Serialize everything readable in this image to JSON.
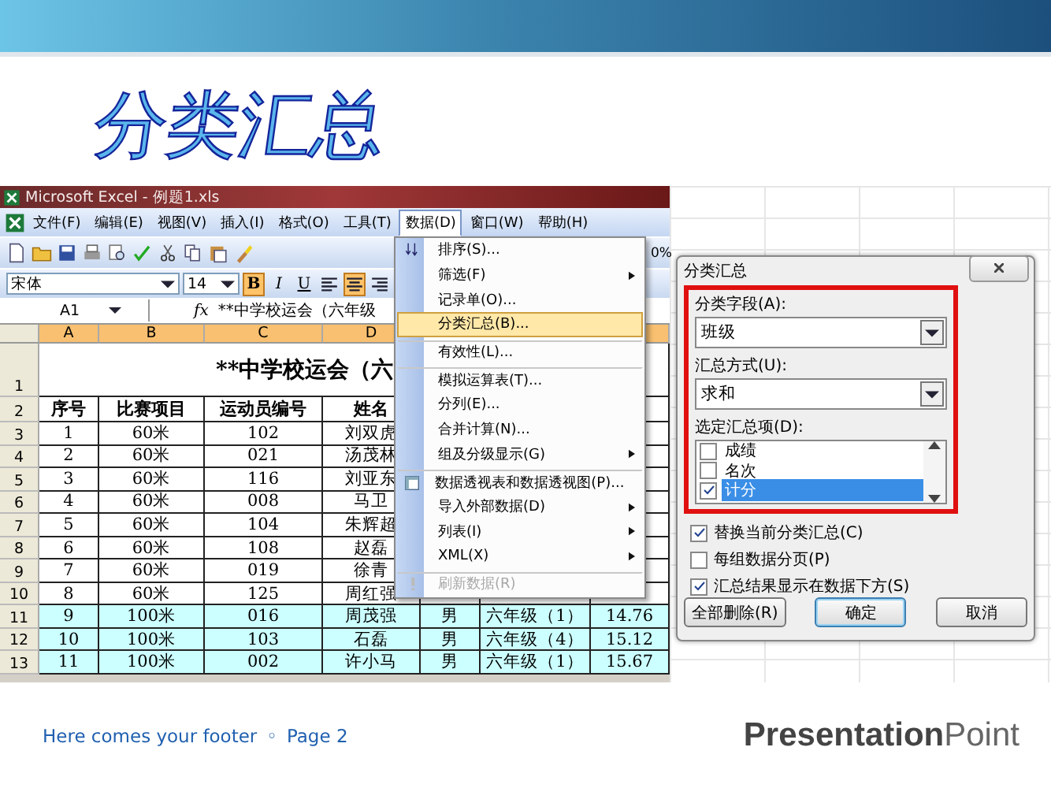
{
  "slide_title": "分类汇总",
  "excel": {
    "title": "Microsoft Excel - 例题1.xls",
    "menu_bar": [
      {
        "label": "文件(F)",
        "selected": false
      },
      {
        "label": "编辑(E)",
        "selected": false
      },
      {
        "label": "视图(V)",
        "selected": false
      },
      {
        "label": "插入(I)",
        "selected": false
      },
      {
        "label": "格式(O)",
        "selected": false
      },
      {
        "label": "工具(T)",
        "selected": false
      },
      {
        "label": "数据(D)",
        "selected": true
      },
      {
        "label": "窗口(W)",
        "selected": false
      },
      {
        "label": "帮助(H)",
        "selected": false
      }
    ],
    "zoom_text": "0%",
    "font_name": "宋体",
    "font_size": "14",
    "format_buttons": [
      {
        "label": "B",
        "on": true
      },
      {
        "label": "I",
        "on": false
      },
      {
        "label": "U",
        "on": false
      }
    ],
    "align_buttons": [
      {
        "on": false
      },
      {
        "on": true
      },
      {
        "on": false
      }
    ],
    "name_box": "A1",
    "function_label": "fx",
    "formula": "**中学校运会（六年级",
    "column_headers": [
      "A",
      "B",
      "C",
      "D"
    ],
    "title_row": {
      "number": "1",
      "text": "**中学校运会（六"
    },
    "rows": [
      {
        "number": "2",
        "kind": "header",
        "shaded": false,
        "cells": [
          "序号",
          "比赛项目",
          "运动员编号",
          "姓名"
        ]
      },
      {
        "number": "3",
        "kind": "data",
        "shaded": false,
        "cells": [
          "1",
          "60米",
          "102",
          "刘双虎"
        ]
      },
      {
        "number": "4",
        "kind": "data",
        "shaded": false,
        "cells": [
          "2",
          "60米",
          "021",
          "汤茂林"
        ]
      },
      {
        "number": "5",
        "kind": "data",
        "shaded": false,
        "cells": [
          "3",
          "60米",
          "116",
          "刘亚东"
        ]
      },
      {
        "number": "6",
        "kind": "data",
        "shaded": false,
        "cells": [
          "4",
          "60米",
          "008",
          "马卫"
        ]
      },
      {
        "number": "7",
        "kind": "data",
        "shaded": false,
        "cells": [
          "5",
          "60米",
          "104",
          "朱辉超"
        ]
      },
      {
        "number": "8",
        "kind": "data",
        "shaded": false,
        "cells": [
          "6",
          "60米",
          "108",
          "赵磊"
        ]
      },
      {
        "number": "9",
        "kind": "data",
        "shaded": false,
        "cells": [
          "7",
          "60米",
          "019",
          "徐青"
        ]
      },
      {
        "number": "10",
        "kind": "data",
        "shaded": false,
        "cells": [
          "8",
          "60米",
          "125",
          "周红强"
        ]
      },
      {
        "number": "11",
        "kind": "data",
        "shaded": true,
        "cells": [
          "9",
          "100米",
          "016",
          "周茂强",
          "男",
          "六年级（1）",
          "14.76"
        ]
      },
      {
        "number": "12",
        "kind": "data",
        "shaded": true,
        "cells": [
          "10",
          "100米",
          "103",
          "石磊",
          "男",
          "六年级（4）",
          "15.12"
        ]
      },
      {
        "number": "13",
        "kind": "data",
        "shaded": true,
        "cells": [
          "11",
          "100米",
          "002",
          "许小马",
          "男",
          "六年级（1）",
          "15.67"
        ]
      }
    ]
  },
  "data_menu": {
    "items": [
      {
        "label": "排序(S)...",
        "kind": "sort",
        "submenu": false,
        "selected": false,
        "disabled": false,
        "divider_before": false
      },
      {
        "label": "筛选(F)",
        "kind": "plain",
        "submenu": true,
        "selected": false,
        "disabled": false,
        "divider_before": false
      },
      {
        "label": "记录单(O)...",
        "kind": "plain",
        "submenu": false,
        "selected": false,
        "disabled": false,
        "divider_before": false
      },
      {
        "label": "分类汇总(B)...",
        "kind": "plain",
        "submenu": false,
        "selected": true,
        "disabled": false,
        "divider_before": false
      },
      {
        "label": "有效性(L)...",
        "kind": "plain",
        "submenu": false,
        "selected": false,
        "disabled": false,
        "divider_before": true
      },
      {
        "label": "模拟运算表(T)...",
        "kind": "plain",
        "submenu": false,
        "selected": false,
        "disabled": false,
        "divider_before": true
      },
      {
        "label": "分列(E)...",
        "kind": "plain",
        "submenu": false,
        "selected": false,
        "disabled": false,
        "divider_before": false
      },
      {
        "label": "合并计算(N)...",
        "kind": "plain",
        "submenu": false,
        "selected": false,
        "disabled": false,
        "divider_before": false
      },
      {
        "label": "组及分级显示(G)",
        "kind": "plain",
        "submenu": true,
        "selected": false,
        "disabled": false,
        "divider_before": false
      },
      {
        "label": "数据透视表和数据透视图(P)...",
        "kind": "pivot",
        "submenu": false,
        "selected": false,
        "disabled": false,
        "divider_before": true
      },
      {
        "label": "导入外部数据(D)",
        "kind": "plain",
        "submenu": true,
        "selected": false,
        "disabled": false,
        "divider_before": false
      },
      {
        "label": "列表(I)",
        "kind": "plain",
        "submenu": true,
        "selected": false,
        "disabled": false,
        "divider_before": false
      },
      {
        "label": "XML(X)",
        "kind": "plain",
        "submenu": true,
        "selected": false,
        "disabled": false,
        "divider_before": false
      },
      {
        "label": "刷新数据(R)",
        "kind": "refresh",
        "submenu": false,
        "selected": false,
        "disabled": true,
        "divider_before": true
      }
    ]
  },
  "dialog": {
    "title": "分类汇总",
    "field_label": "分类字段(A):",
    "field_value": "班级",
    "method_label": "汇总方式(U):",
    "method_value": "求和",
    "items_label": "选定汇总项(D):",
    "items": [
      {
        "label": "成绩",
        "checked": false,
        "selected": false
      },
      {
        "label": "名次",
        "checked": false,
        "selected": false
      },
      {
        "label": "计分",
        "checked": true,
        "selected": true
      }
    ],
    "options": [
      {
        "label": "替换当前分类汇总(C)",
        "checked": true
      },
      {
        "label": "每组数据分页(P)",
        "checked": false
      },
      {
        "label": "汇总结果显示在数据下方(S)",
        "checked": true
      }
    ],
    "buttons": [
      {
        "label": "全部删除(R)",
        "default": false
      },
      {
        "label": "确定",
        "default": true
      },
      {
        "label": "取消",
        "default": false
      }
    ]
  },
  "footer": {
    "text": "Here comes your footer",
    "separator": "◦",
    "page": "Page 2",
    "logo_bold": "Presentation",
    "logo_light": "Point"
  }
}
